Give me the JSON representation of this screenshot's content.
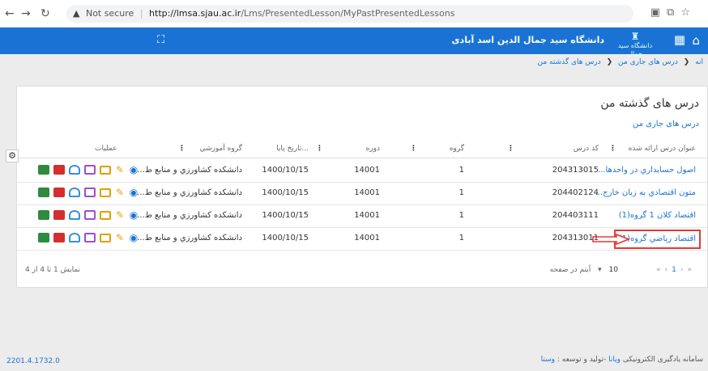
{
  "browser": {
    "security": "Not secure",
    "url_host": "http://lmsa.sjau.ac.ir",
    "url_path": "/Lms/PresentedLesson/MyPastPresentedLessons"
  },
  "header": {
    "university": "دانشگاه سید جمال الدین اسد آبادی",
    "logo_text": "دانشگاه سید جمال الدین اسد آبادی"
  },
  "breadcrumb": {
    "item1": "انه",
    "item2": "درس های جاری من",
    "item3": "درس های گذشته من"
  },
  "page": {
    "title": "درس های گذشته من",
    "current_link": "درس های جاری من"
  },
  "table": {
    "headers": {
      "name": "عنوان درس ارائه شده",
      "code": "کد درس",
      "group": "گروه",
      "term": "دوره",
      "date": "تاریخ پایا...",
      "dept": "گروه آموزشي",
      "ops": "عملیات"
    },
    "rows": [
      {
        "name": "اصول حسابداري در واحدها...",
        "code": "204313015",
        "group": "1",
        "term": "14001",
        "date": "1400/10/15",
        "dept": "دانشکده کشاورزي و منابع ط..."
      },
      {
        "name": "متون اقتصادي به زبان خارج...",
        "code": "204402124",
        "group": "1",
        "term": "14001",
        "date": "1400/10/15",
        "dept": "دانشکده کشاورزي و منابع ط..."
      },
      {
        "name": "اقتصاد كلان 1 گروه(1)",
        "code": "204403111",
        "group": "1",
        "term": "14001",
        "date": "1400/10/15",
        "dept": "دانشکده کشاورزي و منابع ط..."
      },
      {
        "name": "اقتصاد رياضي گروه(1)",
        "code": "204313011",
        "group": "1",
        "term": "14001",
        "date": "1400/10/15",
        "dept": "دانشکده کشاورزي و منابع ط..."
      }
    ],
    "showing": "نمایش 1 تا 4 از 4",
    "per_page_label": "آیتم در صفحه",
    "per_page_value": "10",
    "current_page": "1"
  },
  "footer": {
    "version": "2201.4.1732.0",
    "brand_prefix": "سامانه یادگیری الکترونیکی",
    "brand_name": "ویانا",
    "brand_suffix": "-تولید و توسعه :",
    "brand_vendor": "وستا"
  },
  "colors": {
    "accent": "#1a73d4",
    "highlight": "#e53935"
  }
}
